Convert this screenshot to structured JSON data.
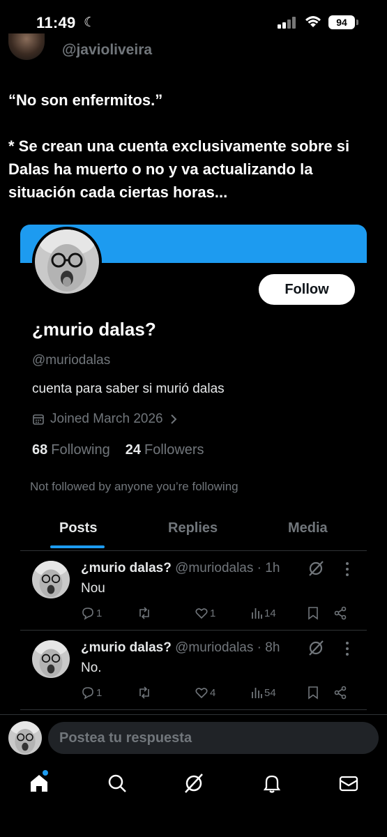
{
  "status": {
    "time": "11:49",
    "battery": "94"
  },
  "author": {
    "handle": "@javioliveira"
  },
  "tweet": {
    "line1": "“No son enfermitos.”",
    "line2": "* Se crean una cuenta exclusivamente sobre si Dalas ha muerto o no y va actualizando la situación cada ciertas horas..."
  },
  "profile": {
    "follow_label": "Follow",
    "display_name": "¿murio dalas?",
    "handle": "@muriodalas",
    "bio": "cuenta para saber si murió dalas",
    "joined": "Joined March 2026",
    "following_count": "68",
    "following_label": "Following",
    "followers_count": "24",
    "followers_label": "Followers",
    "not_followed": "Not followed by anyone you’re following",
    "banner_color": "#1d9bf0"
  },
  "tabs": [
    {
      "label": "Posts",
      "active": true
    },
    {
      "label": "Replies",
      "active": false
    },
    {
      "label": "Media",
      "active": false
    }
  ],
  "posts": [
    {
      "name": "¿murio dalas?",
      "handle": "@muriodalas",
      "time": "1h",
      "text": "Nou",
      "replies": "1",
      "reposts": "",
      "likes": "1",
      "views": "14"
    },
    {
      "name": "¿murio dalas?",
      "handle": "@muriodalas",
      "time": "8h",
      "text": "No.",
      "replies": "1",
      "reposts": "",
      "likes": "4",
      "views": "54"
    }
  ],
  "reply_bar": {
    "placeholder": "Postea tu respuesta"
  },
  "nav": {
    "items": [
      "home-icon",
      "search-icon",
      "grok-icon",
      "notifications-icon",
      "messages-icon"
    ],
    "accent": "#1d9bf0"
  }
}
